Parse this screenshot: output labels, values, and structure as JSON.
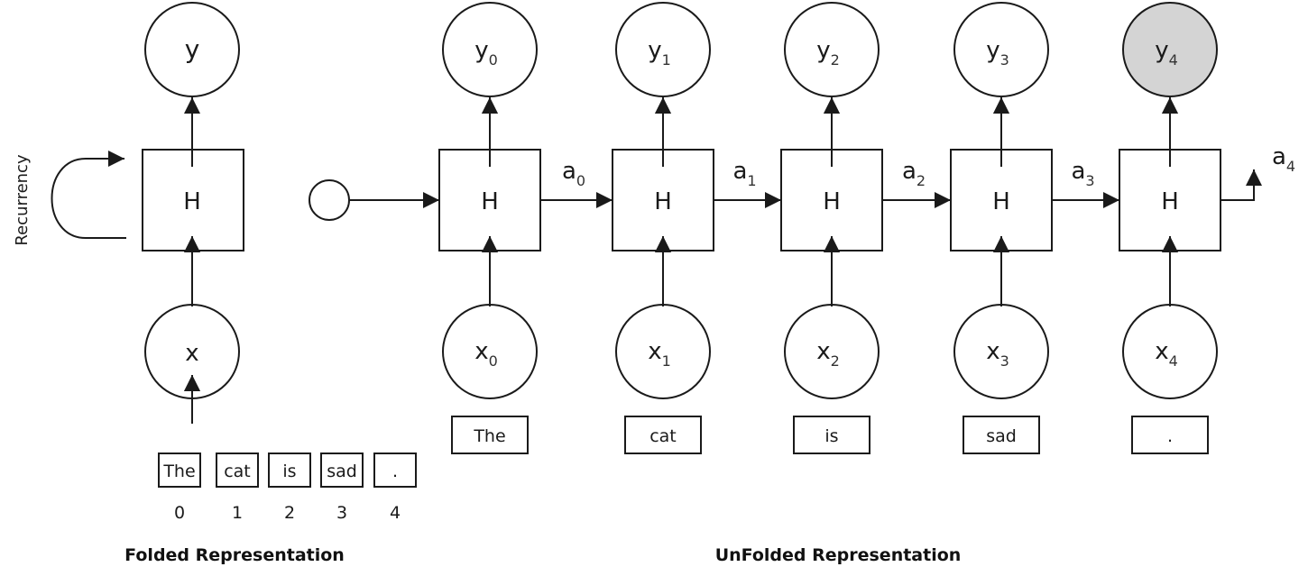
{
  "folded": {
    "title": "Folded Representation",
    "output_label": "y",
    "hidden_label": "H",
    "input_label": "x",
    "recurrency_label": "Recurrency",
    "tokens": [
      "The",
      "cat",
      "is",
      "sad",
      "."
    ],
    "indices": [
      "0",
      "1",
      "2",
      "3",
      "4"
    ]
  },
  "unfolded": {
    "title": "UnFolded Representation",
    "steps": [
      {
        "output": "y",
        "output_sub": "0",
        "hidden": "H",
        "input": "x",
        "input_sub": "0",
        "token": "The",
        "state": "a",
        "state_sub": "0"
      },
      {
        "output": "y",
        "output_sub": "1",
        "hidden": "H",
        "input": "x",
        "input_sub": "1",
        "token": "cat",
        "state": "a",
        "state_sub": "1"
      },
      {
        "output": "y",
        "output_sub": "2",
        "hidden": "H",
        "input": "x",
        "input_sub": "2",
        "token": "is",
        "state": "a",
        "state_sub": "2"
      },
      {
        "output": "y",
        "output_sub": "3",
        "hidden": "H",
        "input": "x",
        "input_sub": "3",
        "token": "sad",
        "state": "a",
        "state_sub": "3"
      },
      {
        "output": "y",
        "output_sub": "4",
        "hidden": "H",
        "input": "x",
        "input_sub": "4",
        "token": ".",
        "state": "a",
        "state_sub": "4",
        "highlighted": true
      }
    ]
  },
  "colors": {
    "stroke": "#1a1a1a",
    "highlight_fill": "#d4d4d4",
    "node_fill": "#ffffff"
  }
}
